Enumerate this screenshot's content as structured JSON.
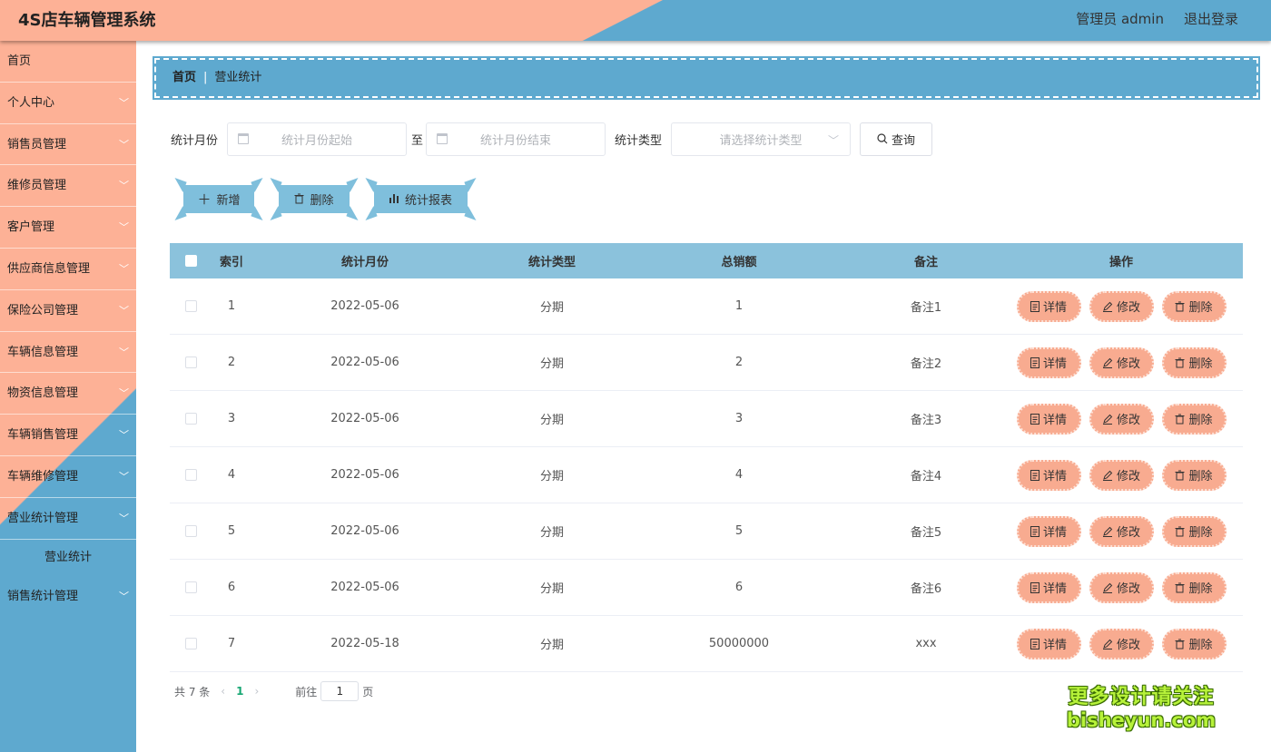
{
  "header": {
    "title": "4S店车辆管理系统",
    "user": "管理员 admin",
    "logout": "退出登录"
  },
  "sidebar": {
    "items": [
      {
        "label": "首页",
        "chevron": false
      },
      {
        "label": "个人中心",
        "chevron": true
      },
      {
        "label": "销售员管理",
        "chevron": true
      },
      {
        "label": "维修员管理",
        "chevron": true
      },
      {
        "label": "客户管理",
        "chevron": true
      },
      {
        "label": "供应商信息管理",
        "chevron": true
      },
      {
        "label": "保险公司管理",
        "chevron": true
      },
      {
        "label": "车辆信息管理",
        "chevron": true
      },
      {
        "label": "物资信息管理",
        "chevron": true
      },
      {
        "label": "车辆销售管理",
        "chevron": true
      },
      {
        "label": "车辆维修管理",
        "chevron": true
      },
      {
        "label": "营业统计管理",
        "chevron": true
      }
    ],
    "active_sub": "营业统计",
    "last_item": "销售统计管理"
  },
  "breadcrumb": {
    "home": "首页",
    "sep": "|",
    "current": "营业统计"
  },
  "search": {
    "month_label": "统计月份",
    "start_placeholder": "统计月份起始",
    "to": "至",
    "end_placeholder": "统计月份结束",
    "type_label": "统计类型",
    "type_placeholder": "请选择统计类型",
    "query": "查询"
  },
  "actions": {
    "add": "新增",
    "delete": "删除",
    "report": "统计报表"
  },
  "table": {
    "headers": {
      "index": "索引",
      "month": "统计月份",
      "type": "统计类型",
      "total": "总销额",
      "note": "备注",
      "ops": "操作"
    },
    "ops": {
      "detail": "详情",
      "edit": "修改",
      "delete": "删除"
    },
    "rows": [
      {
        "index": "1",
        "month": "2022-05-06",
        "type": "分期",
        "total": "1",
        "note": "备注1"
      },
      {
        "index": "2",
        "month": "2022-05-06",
        "type": "分期",
        "total": "2",
        "note": "备注2"
      },
      {
        "index": "3",
        "month": "2022-05-06",
        "type": "分期",
        "total": "3",
        "note": "备注3"
      },
      {
        "index": "4",
        "month": "2022-05-06",
        "type": "分期",
        "total": "4",
        "note": "备注4"
      },
      {
        "index": "5",
        "month": "2022-05-06",
        "type": "分期",
        "total": "5",
        "note": "备注5"
      },
      {
        "index": "6",
        "month": "2022-05-06",
        "type": "分期",
        "total": "6",
        "note": "备注6"
      },
      {
        "index": "7",
        "month": "2022-05-18",
        "type": "分期",
        "total": "50000000",
        "note": "xxx"
      }
    ]
  },
  "pagination": {
    "total": "共 7 条",
    "prev": "‹",
    "page": "1",
    "next": "›",
    "goto": "前往",
    "goto_value": "1",
    "page_unit": "页"
  },
  "watermark": {
    "line1": "更多设计请关注",
    "line2": "bisheyun.com"
  },
  "colors": {
    "peach": "#fdb196",
    "blue": "#5ea9cf",
    "table_header": "#8bc2dc",
    "op_button": "#f8ab90",
    "page_active": "#17a773"
  }
}
